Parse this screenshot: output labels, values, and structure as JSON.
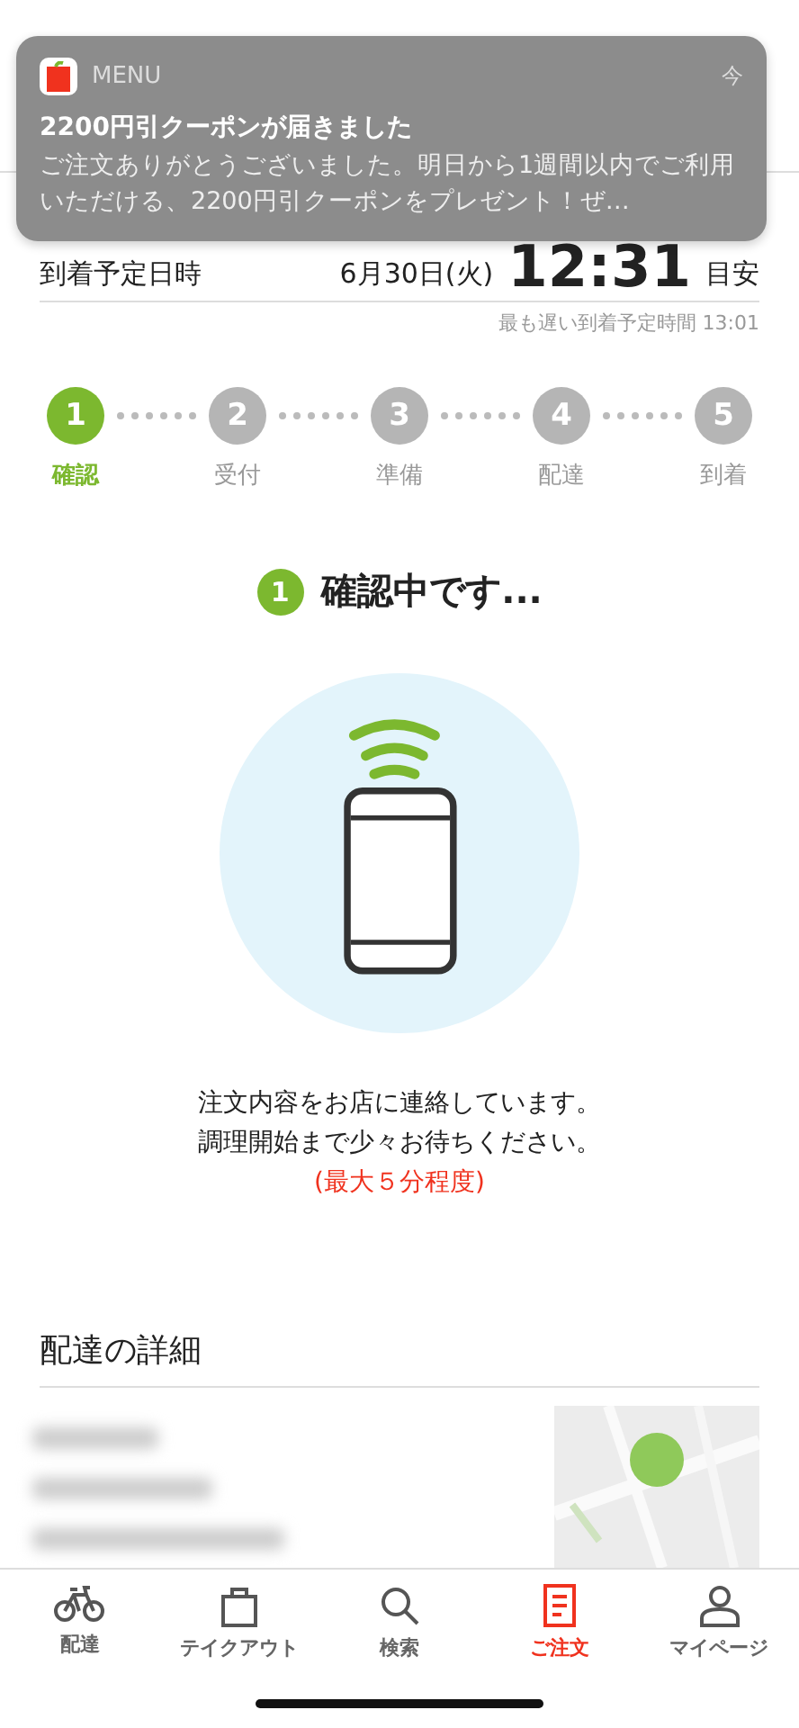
{
  "notification": {
    "app": "MENU",
    "time": "今",
    "title": "2200円引クーポンが届きました",
    "body": "ご注文ありがとうございました。明日から1週間以内でご利用いただける、2200円引クーポンをプレゼント！ぜ…"
  },
  "arrival": {
    "label": "到着予定日時",
    "date": "6月30日(火)",
    "time": "12:31",
    "suffix": "目安",
    "latest": "最も遅い到着予定時間 13:01"
  },
  "steps": [
    {
      "number": "1",
      "label": "確認",
      "selected": true
    },
    {
      "number": "2",
      "label": "受付",
      "selected": false
    },
    {
      "number": "3",
      "label": "準備",
      "selected": false
    },
    {
      "number": "4",
      "label": "配達",
      "selected": false
    },
    {
      "number": "5",
      "label": "到着",
      "selected": false
    }
  ],
  "status": {
    "number": "1",
    "title": "確認中です..."
  },
  "message": [
    "注文内容をお店に連絡しています。",
    "調理開始まで少々お待ちください。"
  ],
  "note": "(最大５分程度)",
  "details": {
    "title": "配達の詳細"
  },
  "tabs": [
    {
      "label": "配達",
      "kind": "bike",
      "selected": false
    },
    {
      "label": "テイクアウト",
      "kind": "bag",
      "selected": false
    },
    {
      "label": "検索",
      "kind": "search",
      "selected": false
    },
    {
      "label": "ご注文",
      "kind": "order",
      "selected": true
    },
    {
      "label": "マイページ",
      "kind": "person",
      "selected": false
    }
  ]
}
